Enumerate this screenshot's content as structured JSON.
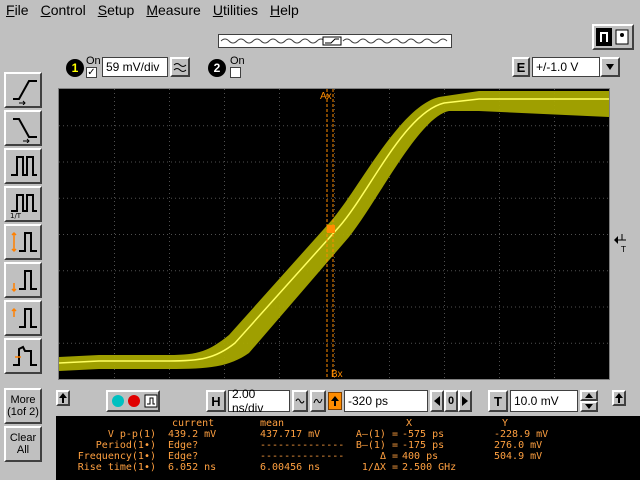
{
  "menu": {
    "file": "File",
    "control": "Control",
    "setup": "Setup",
    "measure": "Measure",
    "utilities": "Utilities",
    "help": "Help"
  },
  "channel1": {
    "number": "1",
    "on_label": "On",
    "on": true,
    "scale": "59 mV/div"
  },
  "channel2": {
    "number": "2",
    "on_label": "On",
    "on": false
  },
  "trigger_edge": {
    "letter": "E",
    "value": "+/-1.0 V"
  },
  "left_buttons": {
    "more_line1": "More",
    "more_line2": "(1of 2)",
    "clear_line1": "Clear",
    "clear_line2": "All"
  },
  "scope": {
    "marker_ax": "Ax",
    "marker_bx": "Bx"
  },
  "timebase": {
    "letter": "H",
    "scale": "2.00 ns/div",
    "delay": "-320 ps",
    "delay_step": "0"
  },
  "trigger": {
    "letter": "T",
    "level": "10.0 mV"
  },
  "measurements": {
    "header_current": "current",
    "header_mean": "mean",
    "header_x": "X",
    "header_y": "Y",
    "rows": [
      {
        "label": "V p-p(1)",
        "current": "439.2 mV",
        "mean": "437.717 mV"
      },
      {
        "label": "Period(1•)",
        "current": "Edge?",
        "mean": "--------------"
      },
      {
        "label": "Frequency(1•)",
        "current": "Edge?",
        "mean": "--------------"
      },
      {
        "label": "Rise time(1•)",
        "current": "6.052 ns",
        "mean": "6.00456 ns"
      }
    ],
    "markers": [
      {
        "label": "A—(1) =",
        "x": "-575 ps",
        "y": "-228.9 mV"
      },
      {
        "label": "B—(1) =",
        "x": "-175 ps",
        "y": "276.0 mV"
      },
      {
        "label": "Δ =",
        "x": "400 ps",
        "y": "504.9 mV"
      },
      {
        "label": "1/ΔX =",
        "x": "2.500 GHz",
        "y": ""
      }
    ]
  },
  "colors": {
    "trace": "#c8c800",
    "trace_highlight": "#ffff80",
    "marker": "#ff8c00",
    "grid": "#505050"
  }
}
